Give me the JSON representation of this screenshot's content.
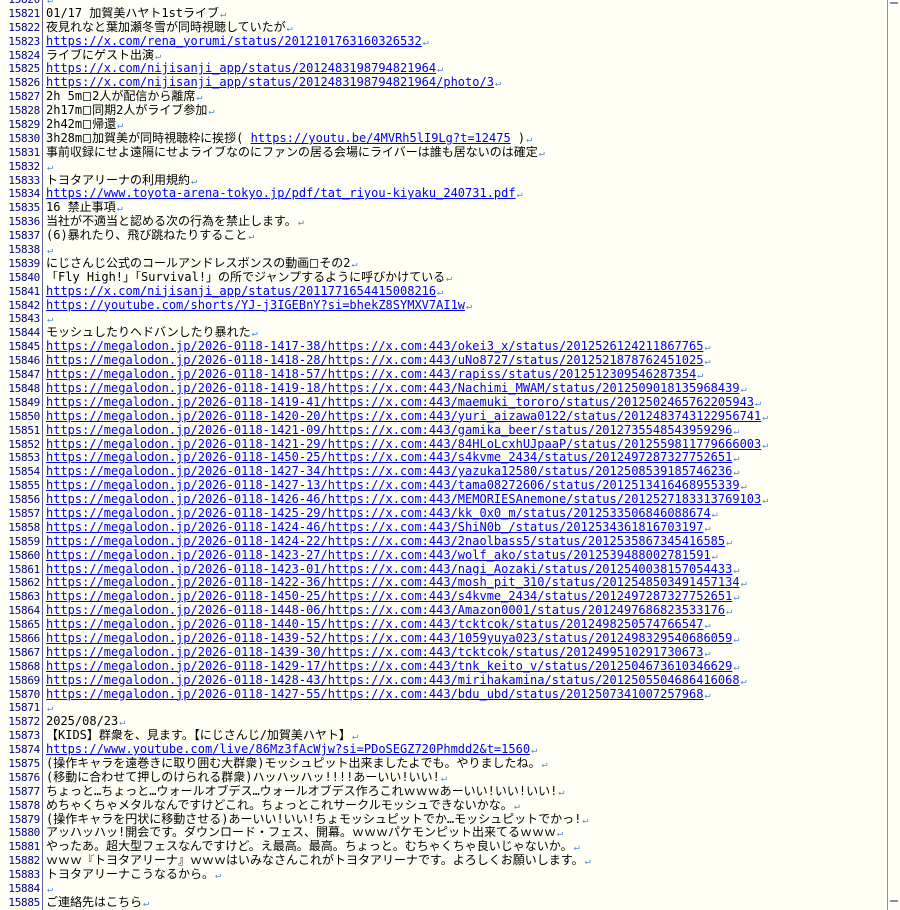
{
  "editor": {
    "eol_mark": "↵",
    "lines": [
      {
        "no": "15820",
        "segs": []
      },
      {
        "no": "15821",
        "segs": [
          {
            "t": "01/17 加賀美ハヤト1stライブ"
          }
        ]
      },
      {
        "no": "15822",
        "segs": [
          {
            "t": "夜見れなと葉加瀬冬雪が同時視聴していたが"
          }
        ]
      },
      {
        "no": "15823",
        "segs": [
          {
            "t": "https://x.com/rena_yorumi/status/2012101763160326532",
            "link": true
          }
        ]
      },
      {
        "no": "15824",
        "segs": [
          {
            "t": "ライブにゲスト出演"
          }
        ]
      },
      {
        "no": "15825",
        "segs": [
          {
            "t": "https://x.com/nijisanji_app/status/2012483198794821964",
            "link": true
          }
        ]
      },
      {
        "no": "15826",
        "segs": [
          {
            "t": "https://x.com/nijisanji_app/status/2012483198794821964/photo/3",
            "link": true
          }
        ]
      },
      {
        "no": "15827",
        "segs": [
          {
            "t": "2h 5m"
          },
          {
            "g": 1
          },
          {
            "t": "2人が配信から離席"
          }
        ]
      },
      {
        "no": "15828",
        "segs": [
          {
            "t": "2h17m"
          },
          {
            "g": 1
          },
          {
            "t": "同期2人がライブ参加"
          }
        ]
      },
      {
        "no": "15829",
        "segs": [
          {
            "t": "2h42m"
          },
          {
            "g": 1
          },
          {
            "t": "帰還"
          }
        ]
      },
      {
        "no": "15830",
        "segs": [
          {
            "t": "3h28m"
          },
          {
            "g": 1
          },
          {
            "t": "加賀美が同時視聴枠に挨拶( "
          },
          {
            "t": "https://youtu.be/4MVRh5lI9Lg?t=12475",
            "link": true
          },
          {
            "t": " )"
          }
        ]
      },
      {
        "no": "15831",
        "segs": [
          {
            "t": "事前収録にせよ遠隔にせよライブなのにファンの居る会場にライバーは誰も居ないのは確定"
          }
        ]
      },
      {
        "no": "15832",
        "segs": []
      },
      {
        "no": "15833",
        "segs": [
          {
            "t": "トヨタアリーナの利用規約"
          }
        ]
      },
      {
        "no": "15834",
        "segs": [
          {
            "t": "https://www.toyota-arena-tokyo.jp/pdf/tat_riyou-kiyaku_240731.pdf",
            "link": true
          }
        ]
      },
      {
        "no": "15835",
        "segs": [
          {
            "t": "16 禁止事項"
          }
        ]
      },
      {
        "no": "15836",
        "segs": [
          {
            "t": "当社が不適当と認める次の行為を禁止します。"
          }
        ]
      },
      {
        "no": "15837",
        "segs": [
          {
            "t": "(6)暴れたり、飛び跳ねたりすること"
          }
        ]
      },
      {
        "no": "15838",
        "segs": []
      },
      {
        "no": "15839",
        "segs": [
          {
            "t": "にじさんじ公式のコールアンドレスポンスの動画"
          },
          {
            "g": 1
          },
          {
            "t": "その2"
          }
        ]
      },
      {
        "no": "15840",
        "segs": [
          {
            "t": "「Fly High!」「Survival!」の所でジャンプするように呼びかけている"
          }
        ]
      },
      {
        "no": "15841",
        "segs": [
          {
            "t": "https://x.com/nijisanji_app/status/2011771654415008216",
            "link": true
          }
        ]
      },
      {
        "no": "15842",
        "segs": [
          {
            "t": "https://youtube.com/shorts/YJ-j3IGEBnY?si=bhekZ8SYMXV7AI1w",
            "link": true
          }
        ]
      },
      {
        "no": "15843",
        "segs": []
      },
      {
        "no": "15844",
        "segs": [
          {
            "t": "モッシュしたりヘドバンしたり暴れた"
          }
        ]
      },
      {
        "no": "15845",
        "segs": [
          {
            "t": "https://megalodon.jp/2026-0118-1417-38/https://x.com:443/okei3_x/status/2012526124211867765",
            "link": true
          }
        ]
      },
      {
        "no": "15846",
        "segs": [
          {
            "t": "https://megalodon.jp/2026-0118-1418-28/https://x.com:443/uNo8727/status/2012521878762451025",
            "link": true
          }
        ]
      },
      {
        "no": "15847",
        "segs": [
          {
            "t": "https://megalodon.jp/2026-0118-1418-57/https://x.com:443/rapiss/status/2012512309546287354",
            "link": true
          }
        ]
      },
      {
        "no": "15848",
        "segs": [
          {
            "t": "https://megalodon.jp/2026-0118-1419-18/https://x.com:443/Nachimi_MWAM/status/2012509018135968439",
            "link": true
          }
        ]
      },
      {
        "no": "15849",
        "segs": [
          {
            "t": "https://megalodon.jp/2026-0118-1419-41/https://x.com:443/maemuki_tororo/status/2012502465762205943",
            "link": true
          }
        ]
      },
      {
        "no": "15850",
        "segs": [
          {
            "t": "https://megalodon.jp/2026-0118-1420-20/https://x.com:443/yuri_aizawa0122/status/2012483743122956741",
            "link": true
          }
        ]
      },
      {
        "no": "15851",
        "segs": [
          {
            "t": "https://megalodon.jp/2026-0118-1421-09/https://x.com:443/gamika_beer/status/2012735548543959296",
            "link": true
          }
        ]
      },
      {
        "no": "15852",
        "segs": [
          {
            "t": "https://megalodon.jp/2026-0118-1421-29/https://x.com:443/84HLoLcxhUJpaaP/status/2012559811779666003",
            "link": true
          }
        ]
      },
      {
        "no": "15853",
        "segs": [
          {
            "t": "https://megalodon.jp/2026-0118-1450-25/https://x.com:443/s4kvme_2434/status/2012497287327752651",
            "link": true
          }
        ]
      },
      {
        "no": "15854",
        "segs": [
          {
            "t": "https://megalodon.jp/2026-0118-1427-34/https://x.com:443/yazuka12580/status/2012508539185746236",
            "link": true
          }
        ]
      },
      {
        "no": "15855",
        "segs": [
          {
            "t": "https://megalodon.jp/2026-0118-1427-13/https://x.com:443/tama08272606/status/2012513416468955339",
            "link": true
          }
        ]
      },
      {
        "no": "15856",
        "segs": [
          {
            "t": "https://megalodon.jp/2026-0118-1426-46/https://x.com:443/MEMORIESAnemone/status/2012527183313769103",
            "link": true
          }
        ]
      },
      {
        "no": "15857",
        "segs": [
          {
            "t": "https://megalodon.jp/2026-0118-1425-29/https://x.com:443/kk_0x0_m/status/2012533506846088674",
            "link": true
          }
        ]
      },
      {
        "no": "15858",
        "segs": [
          {
            "t": "https://megalodon.jp/2026-0118-1424-46/https://x.com:443/ShiN0b_/status/2012534361816703197",
            "link": true
          }
        ]
      },
      {
        "no": "15859",
        "segs": [
          {
            "t": "https://megalodon.jp/2026-0118-1424-22/https://x.com:443/2naolbass5/status/2012535867345416585",
            "link": true
          }
        ]
      },
      {
        "no": "15860",
        "segs": [
          {
            "t": "https://megalodon.jp/2026-0118-1423-27/https://x.com:443/wolf_ako/status/2012539488002781591",
            "link": true
          }
        ]
      },
      {
        "no": "15861",
        "segs": [
          {
            "t": "https://megalodon.jp/2026-0118-1423-01/https://x.com:443/nagi_Aozaki/status/2012540038157054433",
            "link": true
          }
        ]
      },
      {
        "no": "15862",
        "segs": [
          {
            "t": "https://megalodon.jp/2026-0118-1422-36/https://x.com:443/mosh_pit_310/status/2012548503491457134",
            "link": true
          }
        ]
      },
      {
        "no": "15863",
        "segs": [
          {
            "t": "https://megalodon.jp/2026-0118-1450-25/https://x.com:443/s4kvme_2434/status/2012497287327752651",
            "link": true
          }
        ]
      },
      {
        "no": "15864",
        "segs": [
          {
            "t": "https://megalodon.jp/2026-0118-1448-06/https://x.com:443/Amazon0001/status/2012497686823533176",
            "link": true
          }
        ]
      },
      {
        "no": "15865",
        "segs": [
          {
            "t": "https://megalodon.jp/2026-0118-1440-15/https://x.com:443/tcktcok/status/2012498250574766547",
            "link": true
          }
        ]
      },
      {
        "no": "15866",
        "segs": [
          {
            "t": "https://megalodon.jp/2026-0118-1439-52/https://x.com:443/1059yuya023/status/2012498329540686059",
            "link": true
          }
        ]
      },
      {
        "no": "15867",
        "segs": [
          {
            "t": "https://megalodon.jp/2026-0118-1439-30/https://x.com:443/tcktcok/status/2012499510291730673",
            "link": true
          }
        ]
      },
      {
        "no": "15868",
        "segs": [
          {
            "t": "https://megalodon.jp/2026-0118-1429-17/https://x.com:443/tnk_keito_v/status/2012504673610346629",
            "link": true
          }
        ]
      },
      {
        "no": "15869",
        "segs": [
          {
            "t": "https://megalodon.jp/2026-0118-1428-43/https://x.com:443/mirihakamina/status/2012505504686416068",
            "link": true
          }
        ]
      },
      {
        "no": "15870",
        "segs": [
          {
            "t": "https://megalodon.jp/2026-0118-1427-55/https://x.com:443/bdu_ubd/status/2012507341007257968",
            "link": true
          }
        ]
      },
      {
        "no": "15871",
        "segs": []
      },
      {
        "no": "15872",
        "segs": [
          {
            "t": "2025/08/23"
          }
        ]
      },
      {
        "no": "15873",
        "segs": [
          {
            "t": "【KIDS】群衆を、見ます。【にじさんじ/加賀美ハヤト】"
          }
        ]
      },
      {
        "no": "15874",
        "segs": [
          {
            "t": "https://www.youtube.com/live/86Mz3fAcWjw?si=PDoSEGZ720Phmdd2&t=1560",
            "link": true
          }
        ]
      },
      {
        "no": "15875",
        "segs": [
          {
            "t": "(操作キャラを遠巻きに取り囲む大群衆)モッシュピット出来ましたよでも。やりましたね。"
          }
        ]
      },
      {
        "no": "15876",
        "segs": [
          {
            "t": "(移動に合わせて押しのけられる群衆)ハッハッハッ!!!!あーいい!いい!"
          }
        ]
      },
      {
        "no": "15877",
        "segs": [
          {
            "t": "ちょっと…ちょっと…ウォールオブデス…ウォールオブデス作ろこれｗｗｗあーいい!いい!いい!"
          }
        ]
      },
      {
        "no": "15878",
        "segs": [
          {
            "t": "めちゃくちゃメタルなんですけどこれ。ちょっとこれサークルモッシュできないかな。"
          }
        ]
      },
      {
        "no": "15879",
        "segs": [
          {
            "t": "(操作キャラを円状に移動させる)あーいい!いい!ちょモッシュピットでか…モッシュピットでかっ!"
          }
        ]
      },
      {
        "no": "15880",
        "segs": [
          {
            "t": "アッハッハッ!開会です。ダウンロード・フェス、開幕。ｗｗｗパケモンピット出来てるｗｗｗ"
          }
        ]
      },
      {
        "no": "15881",
        "segs": [
          {
            "t": "やったあ。超大型フェスなんですけど。え最高。最高。ちょっと。むちゃくちゃ良いじゃないか。"
          }
        ]
      },
      {
        "no": "15882",
        "segs": [
          {
            "t": "ｗｗｗ『トヨタアリーナ』ｗｗｗはいみなさんこれがトヨタアリーナです。よろしくお願いします。"
          }
        ]
      },
      {
        "no": "15883",
        "segs": [
          {
            "t": "トヨタアリーナこうなるから。"
          }
        ]
      },
      {
        "no": "15884",
        "segs": []
      },
      {
        "no": "15885",
        "segs": [
          {
            "t": "ご連絡先はこちら"
          }
        ]
      }
    ]
  }
}
